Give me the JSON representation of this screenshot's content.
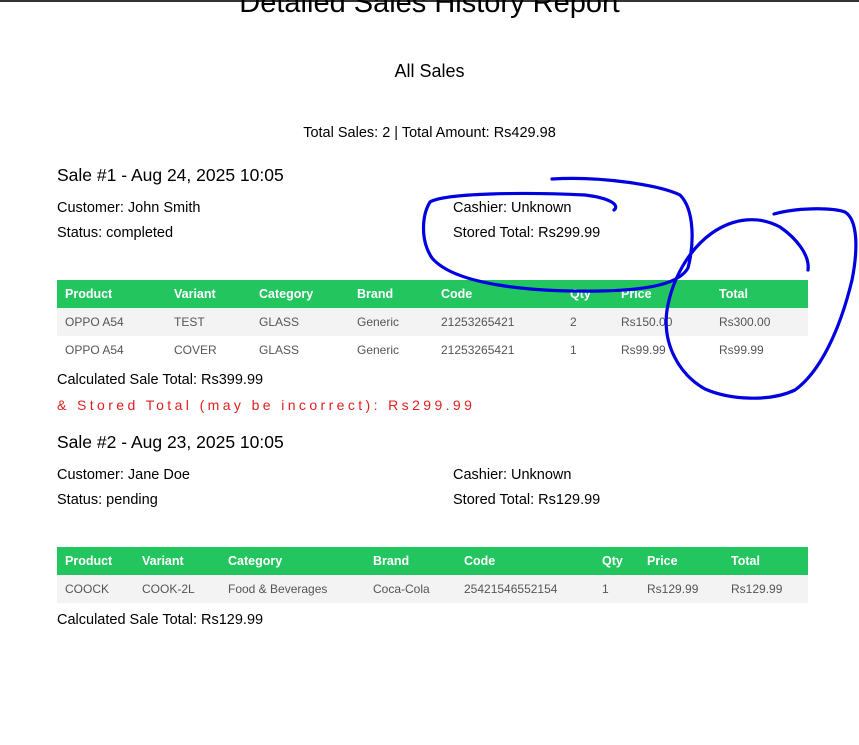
{
  "report": {
    "title": "Detailed Sales History Report",
    "subtitle": "All Sales",
    "summary": "Total Sales: 2 | Total Amount: Rs429.98"
  },
  "table_headers": [
    "Product",
    "Variant",
    "Category",
    "Brand",
    "Code",
    "Qty",
    "Price",
    "Total"
  ],
  "sales": [
    {
      "header": "Sale #1 - Aug 24, 2025 10:05",
      "customer": "Customer: John Smith",
      "status": "Status: completed",
      "cashier": "Cashier: Unknown",
      "stored_total": "Stored Total: Rs299.99",
      "rows": [
        [
          "OPPO A54",
          "TEST",
          "GLASS",
          "Generic",
          "21253265421",
          "2",
          "Rs150.00",
          "Rs300.00"
        ],
        [
          "OPPO A54",
          "COVER",
          "GLASS",
          "Generic",
          "21253265421",
          "1",
          "Rs99.99",
          "Rs99.99"
        ]
      ],
      "calculated_total": "Calculated Sale Total: Rs399.99",
      "warning": "& Stored Total (may be incorrect): Rs299.99"
    },
    {
      "header": "Sale #2 - Aug 23, 2025 10:05",
      "customer": "Customer: Jane Doe",
      "status": "Status: pending",
      "cashier": "Cashier: Unknown",
      "stored_total": "Stored Total: Rs129.99",
      "rows": [
        [
          "COOCK",
          "COOK-2L",
          "Food & Beverages",
          "Coca-Cola",
          "25421546552154",
          "1",
          "Rs129.99",
          "Rs129.99"
        ]
      ],
      "calculated_total": "Calculated Sale Total: Rs129.99"
    }
  ],
  "annotation_color": "#0000e0"
}
